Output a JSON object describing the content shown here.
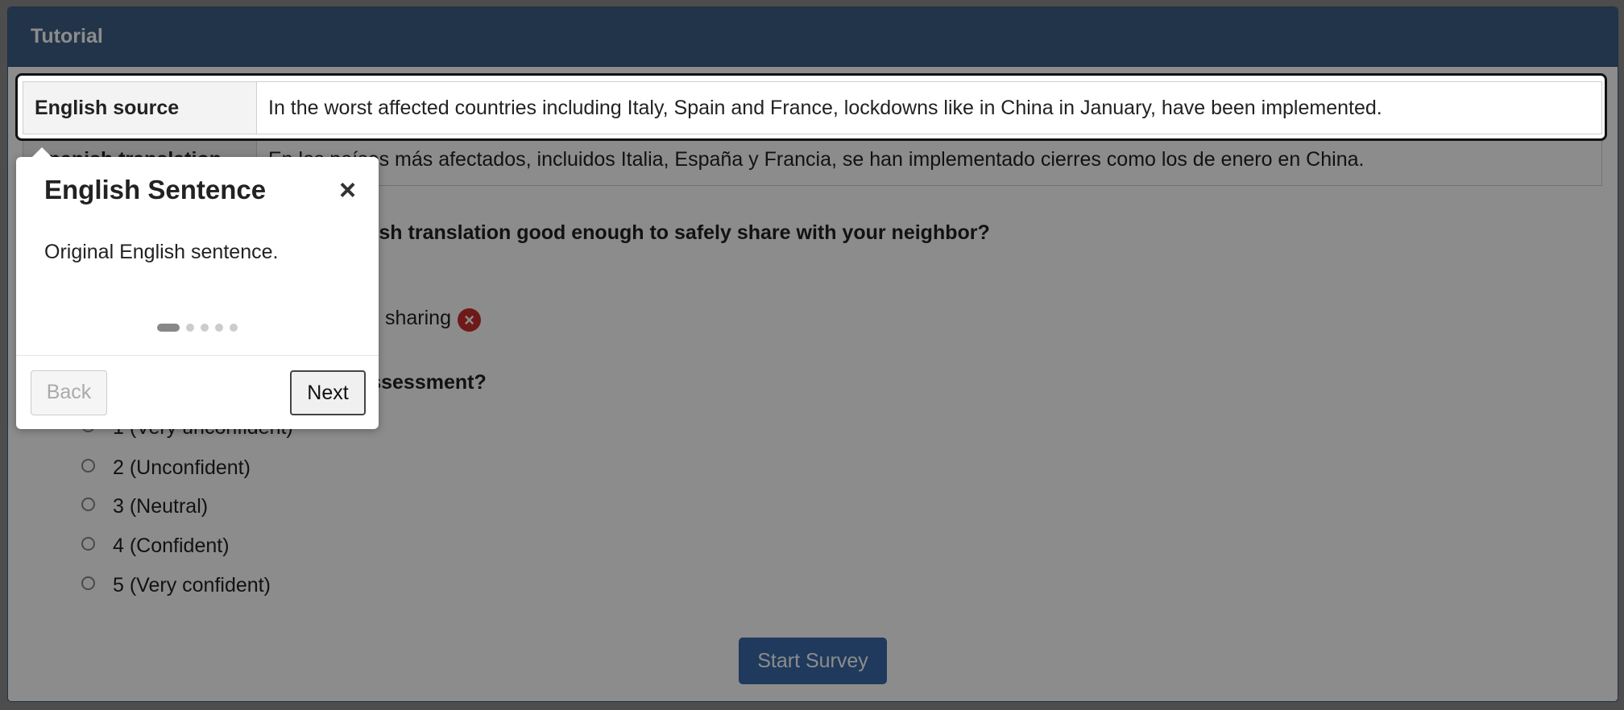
{
  "panel": {
    "title": "Tutorial"
  },
  "table": {
    "source_label": "English source",
    "source_text": "In the worst affected countries including Italy, Spain and France, lockdowns like in China in January, have been implemented.",
    "translation_label": "Spanish translation",
    "translation_text": "En los países más afectados, incluidos Italia, España y Francia, se han implementado cierres como los de enero en China."
  },
  "question1": {
    "text": "Based on the above, is the Spanish translation good enough to safely share with your neighbor?",
    "answer_visible": "sharing",
    "icon": "x-circle-icon"
  },
  "question2": {
    "text": "How confident are you in your assessment?",
    "options": [
      "1 (Very unconfident)",
      "2 (Unconfident)",
      "3 (Neutral)",
      "4 (Confident)",
      "5 (Very confident)"
    ]
  },
  "start_button": "Start Survey",
  "popover": {
    "title": "English Sentence",
    "close": "×",
    "body": "Original English sentence.",
    "step": 1,
    "steps_total": 5,
    "back": "Back",
    "next": "Next"
  }
}
